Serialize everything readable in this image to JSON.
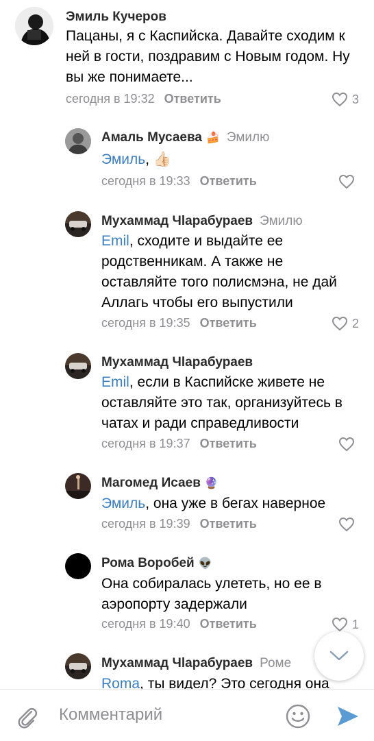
{
  "comments": [
    {
      "author": "Эмиль Кучеров",
      "author_emoji": "",
      "reply_to": "",
      "mention": "",
      "text": "Пацаны, я с Каспийска. Давайте сходим к ней в гости, поздравим с Новым годом. Ну вы же понимаете...",
      "time": "сегодня в 19:32",
      "reply_label": "Ответить",
      "likes": "3"
    },
    {
      "author": "Амаль Мусаева",
      "author_emoji": "🍰",
      "reply_to": "Эмилю",
      "mention": "Эмиль",
      "text": ", 👍🏻",
      "time": "сегодня в 19:33",
      "reply_label": "Ответить",
      "likes": ""
    },
    {
      "author": "Мухаммад Чlарабураев",
      "author_emoji": "",
      "reply_to": "Эмилю",
      "mention": "Emil",
      "text": ", сходите и выдайте ее родственникам. А также не оставляйте того полисмэна, не дай Аллагь чтобы его выпустили",
      "time": "сегодня в 19:35",
      "reply_label": "Ответить",
      "likes": "2"
    },
    {
      "author": "Мухаммад Чlарабураев",
      "author_emoji": "",
      "reply_to": "",
      "mention": "Emil",
      "text": ", если в Каспийске живете не оставляйте это так, организуйтесь в чатах и ради справедливости",
      "time": "сегодня в 19:37",
      "reply_label": "Ответить",
      "likes": ""
    },
    {
      "author": "Магомед Исаев",
      "author_emoji": "🔮",
      "reply_to": "",
      "mention": "Эмиль",
      "text": ", она уже в бегах наверное",
      "time": "сегодня в 19:39",
      "reply_label": "Ответить",
      "likes": ""
    },
    {
      "author": "Рома Воробей",
      "author_emoji": "👽",
      "reply_to": "",
      "mention": "",
      "text": "Она собиралась улететь, но ее в аэропорту задержали",
      "time": "сегодня в 19:40",
      "reply_label": "Ответить",
      "likes": "1"
    },
    {
      "author": "Мухаммад Чlарабураев",
      "author_emoji": "",
      "reply_to": "Роме",
      "mention": "Roma",
      "text": ", ты видел? Это сегодня она",
      "time": "",
      "reply_label": "",
      "likes": ""
    }
  ],
  "composer": {
    "placeholder": "Комментарий"
  },
  "colors": {
    "mention": "#3a7fc4",
    "meta": "#8e8e93",
    "send": "#5a9bd4"
  },
  "icons": {
    "attach": "paperclip-icon",
    "emoji": "smile-icon",
    "send": "send-icon",
    "like": "heart-icon",
    "scroll": "chevron-down-icon"
  }
}
